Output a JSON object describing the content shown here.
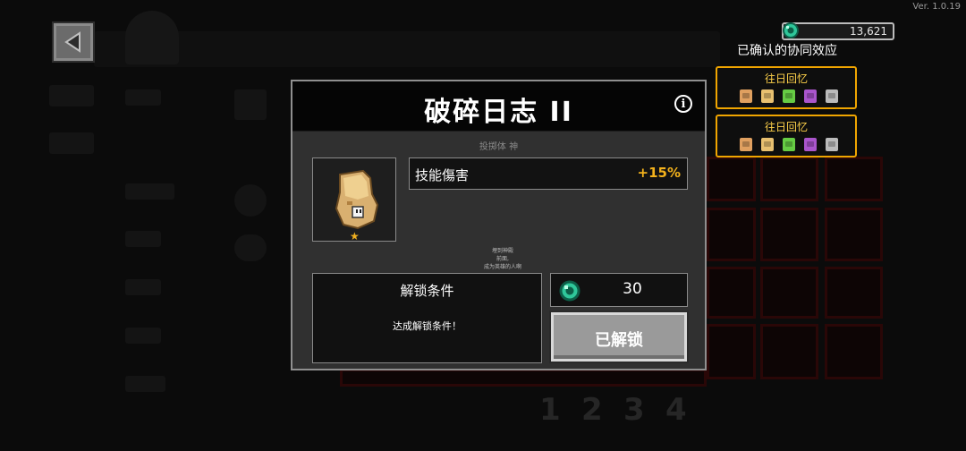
{
  "version": "Ver. 1.0.19",
  "currency": {
    "amount": "13,621",
    "icon": "green-gem-icon"
  },
  "synergy": {
    "title": "已确认的协同效应",
    "cards": [
      {
        "name": "往日回忆",
        "bags": [
          "#e0a060",
          "#e8c070",
          "#66cc44",
          "#aa55cc",
          "#bbbbbb"
        ]
      },
      {
        "name": "往日回忆",
        "bags": [
          "#e0a060",
          "#e8c070",
          "#66cc44",
          "#aa55cc",
          "#bbbbbb"
        ]
      }
    ]
  },
  "modal": {
    "title": "破碎日志 II",
    "subtitle": "投掷体  神",
    "item_icon": "broken-journal-icon",
    "stat": {
      "label": "技能傷害",
      "value": "+15%"
    },
    "flavor": [
      "埋到神殿",
      "前面,",
      "成为英雄的人啊"
    ],
    "unlock": {
      "title": "解锁条件",
      "condition": "达成解锁条件！"
    },
    "cost": {
      "value": "30",
      "icon": "green-gem-icon"
    },
    "unlocked_button": "已解锁"
  },
  "background_pages": [
    "1",
    "2",
    "3",
    "4"
  ],
  "colors": {
    "accent": "#f3b21c",
    "synergy_border": "#f0a500",
    "gem": "#2fc79a"
  }
}
